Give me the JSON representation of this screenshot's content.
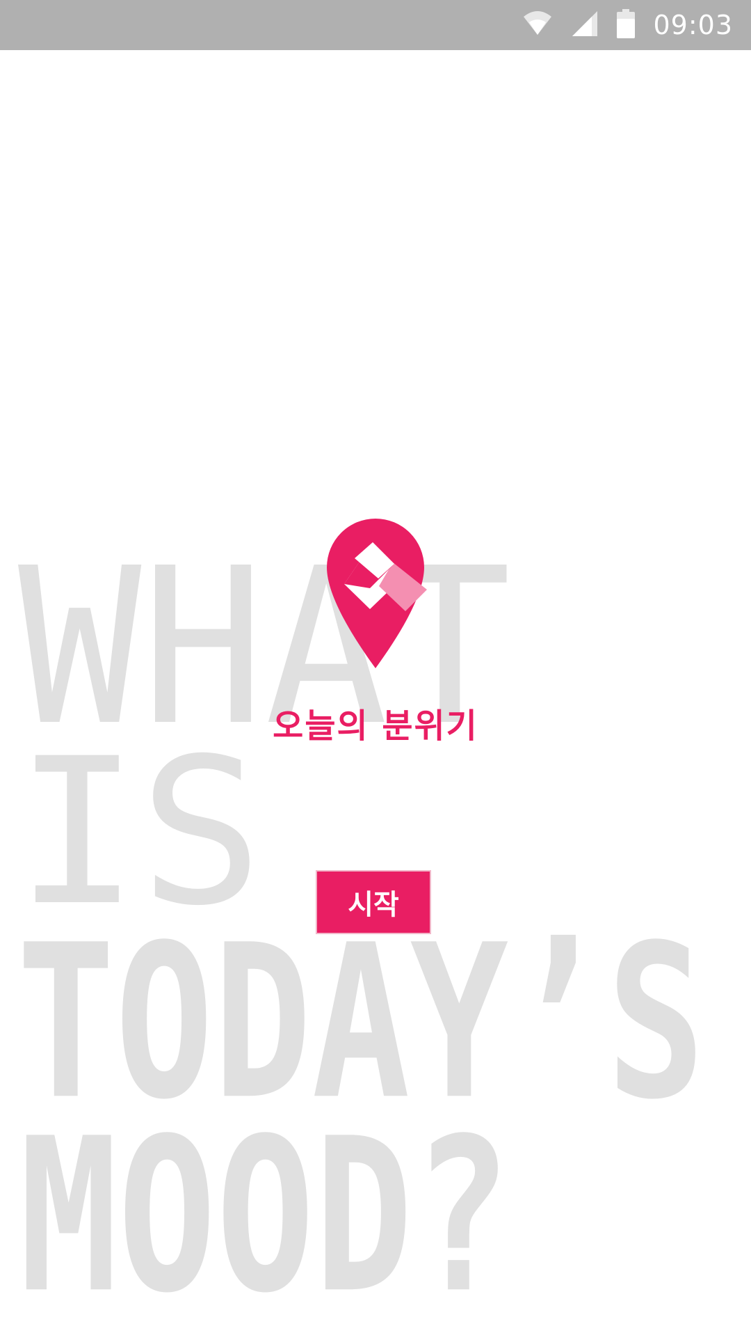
{
  "status_bar": {
    "time": "09:03",
    "icons": [
      "wifi-icon",
      "signal-icon",
      "battery-icon"
    ]
  },
  "background_text": {
    "line1": "WHAT",
    "line2": "IS",
    "line3": "TODAY’S",
    "line4": "MOOD?"
  },
  "app": {
    "title": "오늘의 분위기",
    "logo": "location-pin-icon"
  },
  "start_button": {
    "label": "시작"
  },
  "colors": {
    "accent": "#e91e63",
    "accent_light": "#f48fb1",
    "background_text": "#e0e0e0",
    "status_bar": "#b0b0b0"
  }
}
